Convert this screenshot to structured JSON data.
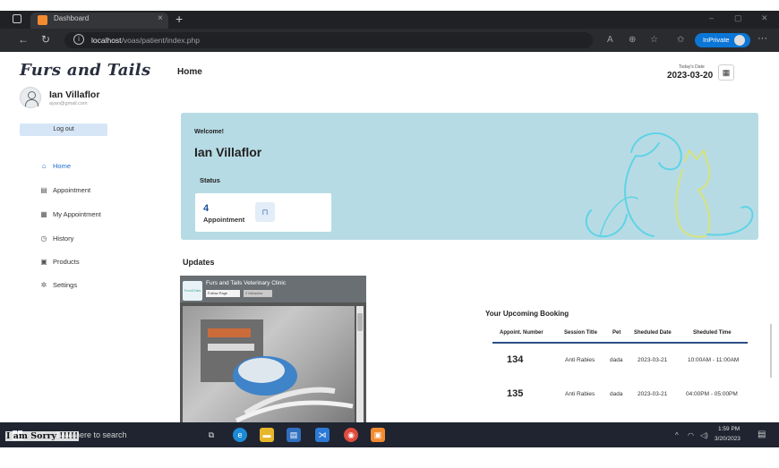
{
  "browser": {
    "tab_title": "Dashboard",
    "tab_close": "×",
    "new_tab": "+",
    "url_host": "localhost",
    "url_path": "/voas/patient/index.php",
    "inprivate_label": "InPrivate",
    "window_controls": [
      "–",
      "▢",
      "✕"
    ]
  },
  "sidebar": {
    "logo": "Furs and Tails",
    "user_name": "Ian Villaflor",
    "user_email": "ayan@gmail.com",
    "logout_label": "Log out",
    "items": [
      {
        "label": "Home",
        "icon": "home-icon",
        "glyph": "⌂"
      },
      {
        "label": "Appointment",
        "icon": "appointment-icon",
        "glyph": "▤"
      },
      {
        "label": "My Appointment",
        "icon": "my-appointment-icon",
        "glyph": "▦"
      },
      {
        "label": "History",
        "icon": "history-icon",
        "glyph": "◷"
      },
      {
        "label": "Products",
        "icon": "products-icon",
        "glyph": "▣"
      },
      {
        "label": "Settings",
        "icon": "settings-icon",
        "glyph": "✲"
      }
    ]
  },
  "header": {
    "title": "Home",
    "date_label": "Today's Date",
    "date_value": "2023-03-20"
  },
  "banner": {
    "welcome": "Welcome!",
    "name": "Ian Villaflor",
    "status_label": "Status",
    "stat_value": "4",
    "stat_label": "Appointment"
  },
  "updates": {
    "label": "Updates",
    "fb_page_title": "Furs and Tails Veterinary Clinic",
    "fb_follow": "Follow Page",
    "fb_likes": "2 followers",
    "fb_logo_text": "Furs&Tails"
  },
  "booking": {
    "title": "Your Upcoming Booking",
    "columns": [
      "Appoint. Number",
      "Session Title",
      "Pet",
      "Sheduled Date",
      "Sheduled Time"
    ],
    "rows": [
      {
        "number": "134",
        "title": "Anti Rabies",
        "pet": "dada",
        "date": "2023-03-21",
        "time": "10:00AM - 11:00AM"
      },
      {
        "number": "135",
        "title": "Anti Rabies",
        "pet": "dada",
        "date": "2023-03-21",
        "time": "04:00PM - 05:00PM"
      }
    ]
  },
  "taskbar": {
    "search_text": "Type here to search",
    "time": "1:59 PM",
    "date": "3/20/2023",
    "overlay_text": "I am Sorry !!!!!"
  },
  "colors": {
    "banner": "#b7dbe4",
    "accent": "#1d6fd1",
    "taskbar": "#1f2430"
  }
}
